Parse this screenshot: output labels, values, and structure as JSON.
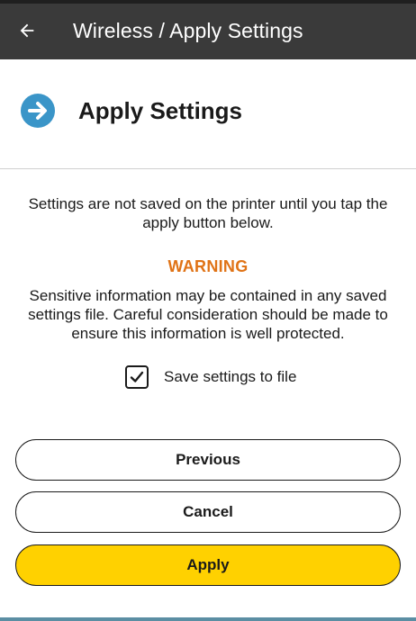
{
  "app_bar": {
    "title": "Wireless / Apply Settings",
    "back_icon": "arrow-left-icon"
  },
  "header": {
    "icon": "arrow-right-circle-icon",
    "icon_color": "#3a95c8",
    "title": "Apply Settings"
  },
  "content": {
    "info_text": "Settings are not saved on the printer until you tap the apply button below.",
    "warning_title": "WARNING",
    "warning_color": "#e07316",
    "warning_text": "Sensitive information may be contained in any saved settings file. Careful consideration should be made to ensure this information is well protected.",
    "save_checkbox": {
      "label": "Save settings to file",
      "checked": true
    }
  },
  "buttons": {
    "previous": "Previous",
    "cancel": "Cancel",
    "apply": "Apply",
    "apply_color": "#ffd100"
  }
}
